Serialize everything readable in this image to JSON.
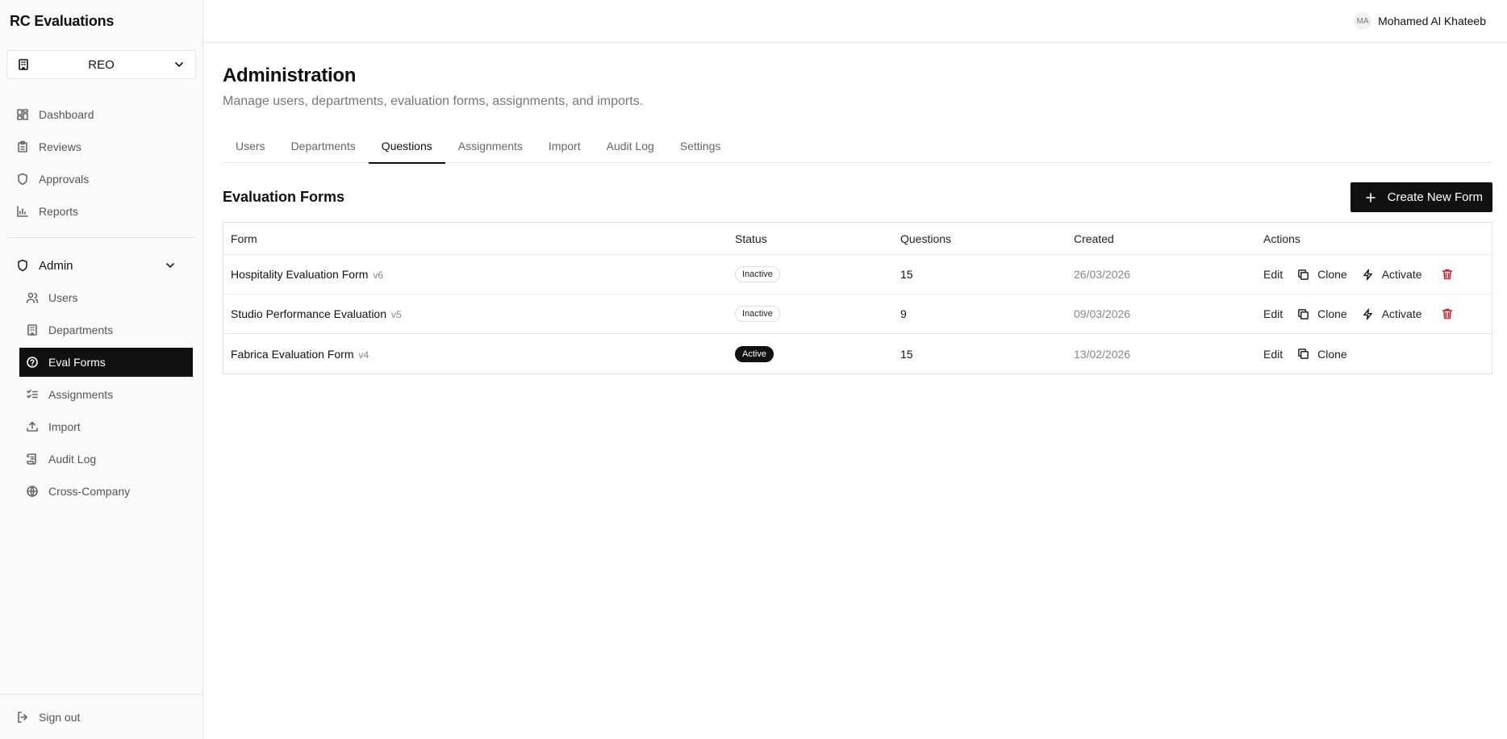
{
  "app": {
    "title": "RC Evaluations"
  },
  "company_select": {
    "value": "REO"
  },
  "nav": {
    "items": [
      {
        "label": "Dashboard",
        "icon": "dashboard-icon"
      },
      {
        "label": "Reviews",
        "icon": "clipboard-icon"
      },
      {
        "label": "Approvals",
        "icon": "shield-icon"
      },
      {
        "label": "Reports",
        "icon": "bar-chart-icon"
      }
    ],
    "admin_group": {
      "label": "Admin"
    },
    "admin_items": [
      {
        "label": "Users",
        "icon": "users-icon"
      },
      {
        "label": "Departments",
        "icon": "building-icon"
      },
      {
        "label": "Eval Forms",
        "icon": "help-circle-icon"
      },
      {
        "label": "Assignments",
        "icon": "list-checks-icon"
      },
      {
        "label": "Import",
        "icon": "upload-icon"
      },
      {
        "label": "Audit Log",
        "icon": "scroll-icon"
      },
      {
        "label": "Cross-Company",
        "icon": "globe-icon"
      }
    ],
    "sign_out": "Sign out"
  },
  "user": {
    "initials": "MA",
    "name": "Mohamed Al Khateeb"
  },
  "page": {
    "title": "Administration",
    "subtitle": "Manage users, departments, evaluation forms, assignments, and imports."
  },
  "tabs": [
    "Users",
    "Departments",
    "Questions",
    "Assignments",
    "Import",
    "Audit Log",
    "Settings"
  ],
  "active_tab": "Questions",
  "section": {
    "title": "Evaluation Forms",
    "create_label": "Create New Form"
  },
  "table": {
    "headers": {
      "form": "Form",
      "status": "Status",
      "questions": "Questions",
      "created": "Created",
      "actions": "Actions"
    },
    "rows": [
      {
        "name": "Hospitality Evaluation Form",
        "version": "v6",
        "status": "Inactive",
        "questions": "15",
        "created": "26/03/2026"
      },
      {
        "name": "Studio Performance Evaluation",
        "version": "v5",
        "status": "Inactive",
        "questions": "9",
        "created": "09/03/2026"
      },
      {
        "name": "Fabrica Evaluation Form",
        "version": "v4",
        "status": "Active",
        "questions": "15",
        "created": "13/02/2026"
      }
    ],
    "actions": {
      "edit": "Edit",
      "clone": "Clone",
      "activate": "Activate"
    }
  },
  "colors": {
    "accent": "#111111",
    "danger": "#c0262d",
    "muted": "#777777"
  }
}
